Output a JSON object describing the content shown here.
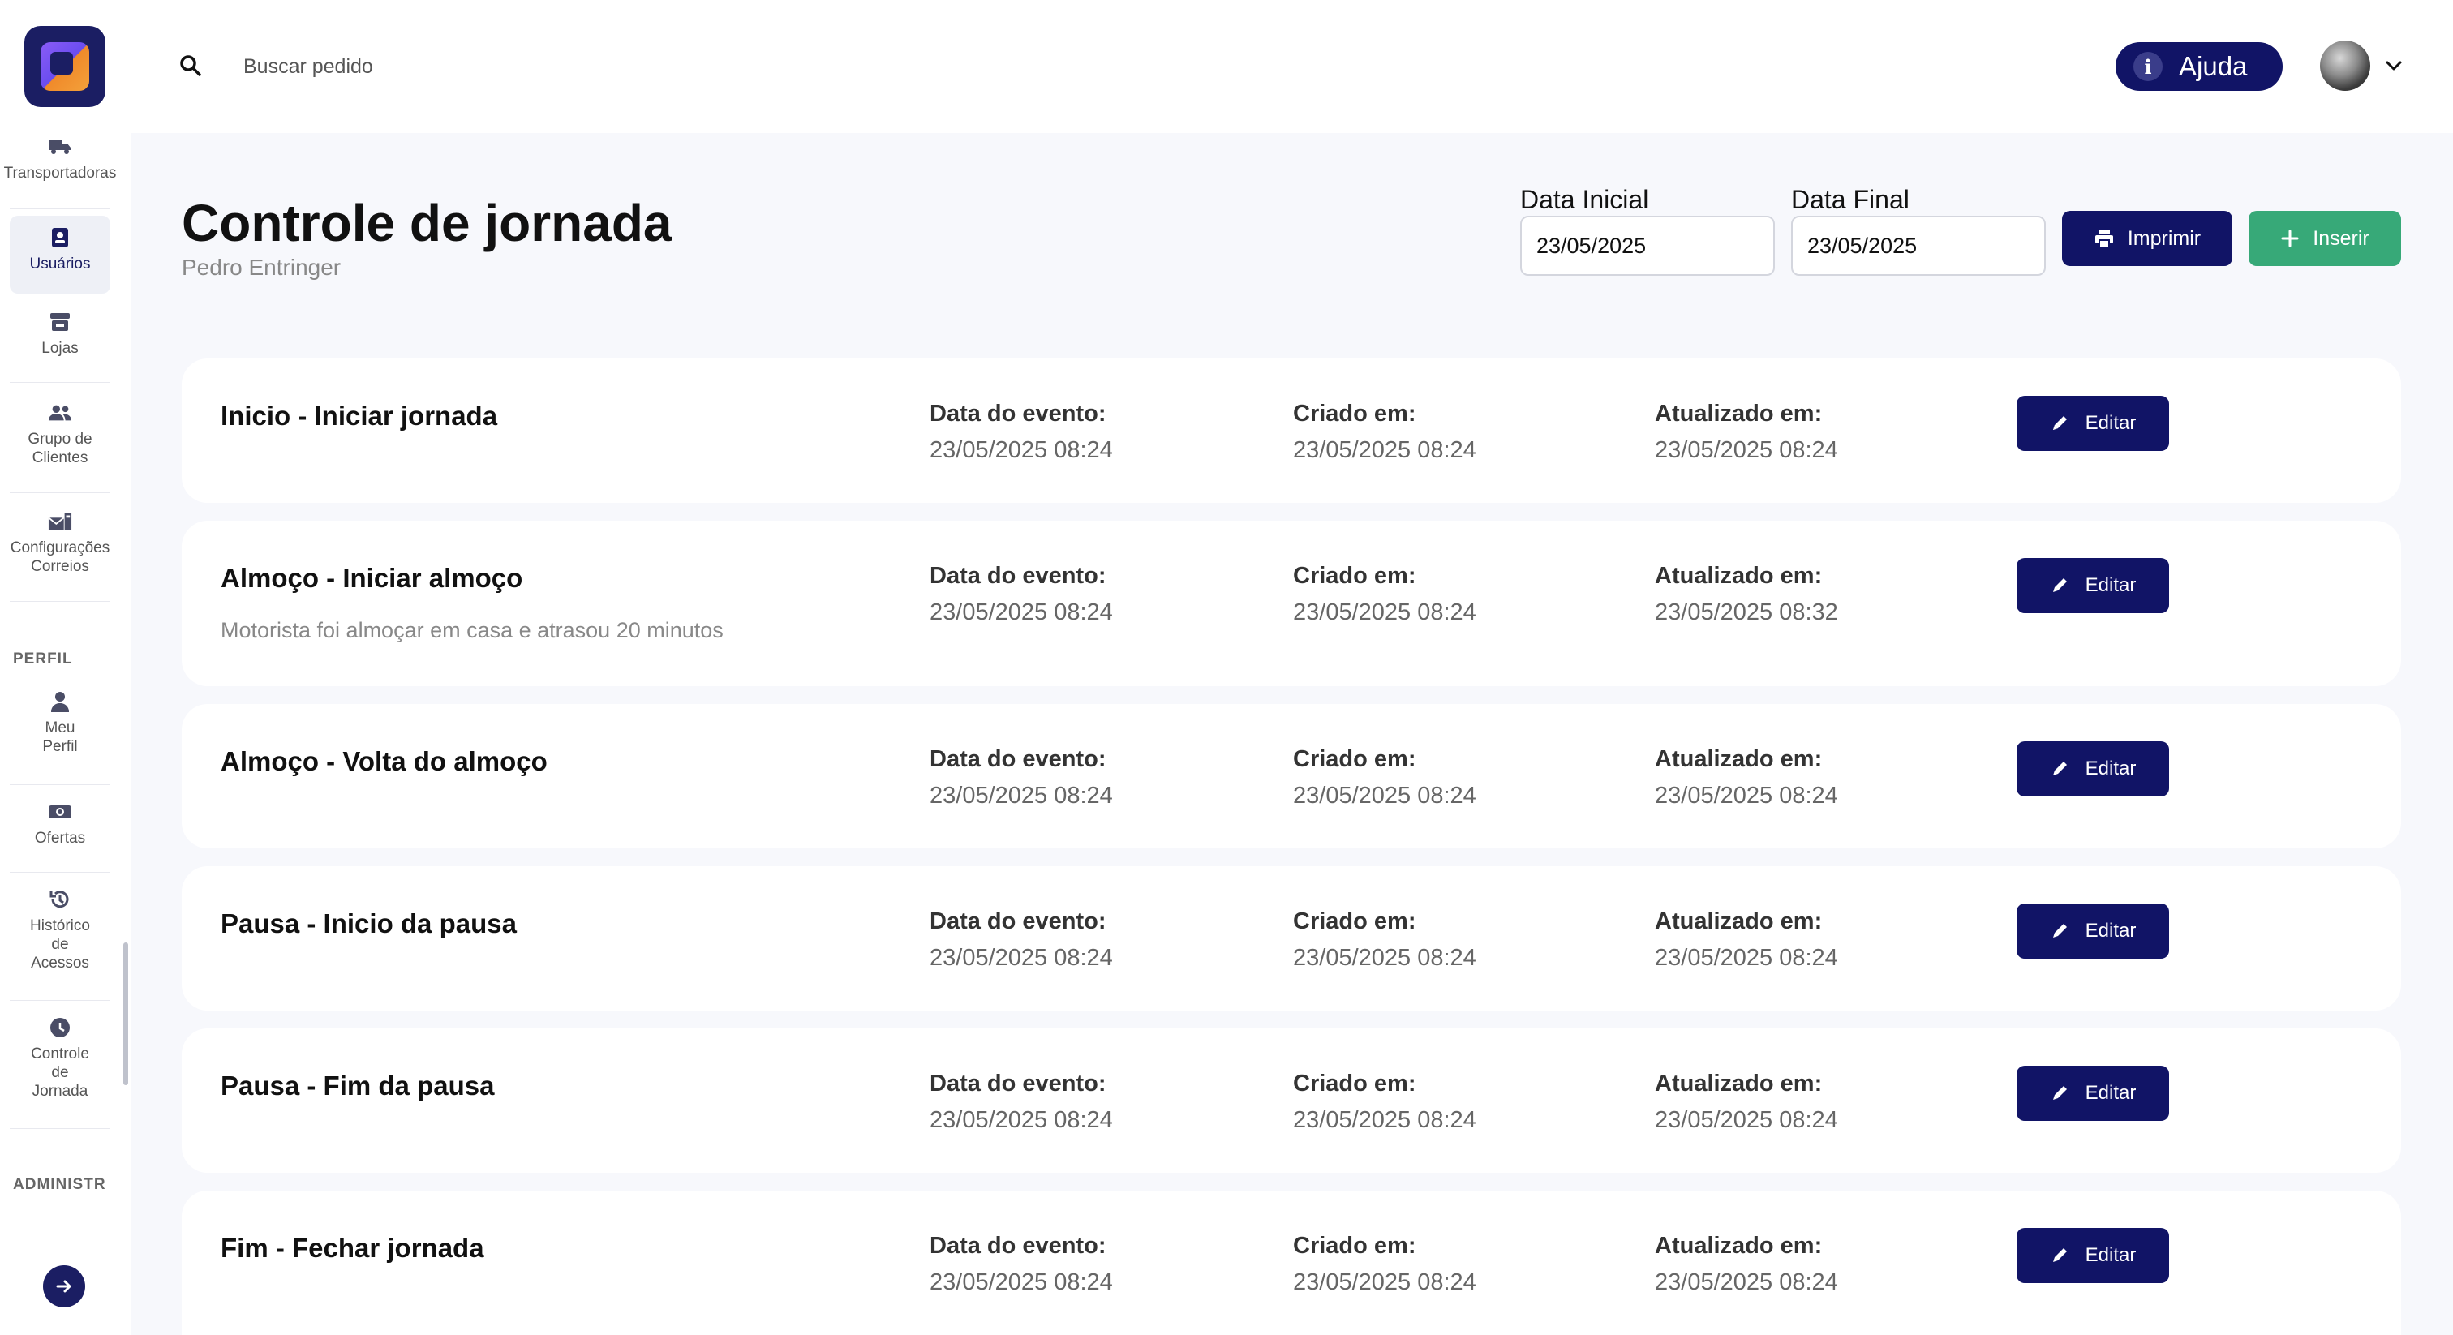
{
  "sidebar": {
    "items": [
      {
        "label": "Transportadoras",
        "icon": "truck-icon"
      },
      {
        "label": "Usuários",
        "icon": "user-badge-icon",
        "active": true
      },
      {
        "label": "Lojas",
        "icon": "store-icon"
      },
      {
        "label": "Grupo de Clientes",
        "icon": "group-icon"
      },
      {
        "label": "Configurações Correios",
        "icon": "mail-config-icon"
      },
      {
        "label": "Meu Perfil",
        "icon": "person-icon"
      },
      {
        "label": "Ofertas",
        "icon": "money-icon"
      },
      {
        "label": "Histórico de Acessos",
        "icon": "history-icon"
      },
      {
        "label": "Controle de Jornada",
        "icon": "clock-icon"
      }
    ],
    "sections": {
      "perfil": "PERFIL",
      "admin": "ADMINISTR"
    }
  },
  "topbar": {
    "search_placeholder": "Buscar pedido",
    "help_label": "Ajuda"
  },
  "header": {
    "title": "Controle de jornada",
    "subtitle": "Pedro Entringer",
    "start_label": "Data Inicial",
    "start_value": "23/05/2025",
    "end_label": "Data Final",
    "end_value": "23/05/2025",
    "print_label": "Imprimir",
    "insert_label": "Inserir"
  },
  "column_labels": {
    "event": "Data do evento:",
    "created": "Criado em:",
    "updated": "Atualizado em:",
    "edit": "Editar"
  },
  "events": [
    {
      "title": "Inicio - Iniciar jornada",
      "note": "",
      "event_date": "23/05/2025 08:24",
      "created": "23/05/2025 08:24",
      "updated": "23/05/2025 08:24"
    },
    {
      "title": "Almoço - Iniciar almoço",
      "note": "Motorista foi almoçar em casa e atrasou 20 minutos",
      "event_date": "23/05/2025 08:24",
      "created": "23/05/2025 08:24",
      "updated": "23/05/2025 08:32"
    },
    {
      "title": "Almoço - Volta do almoço",
      "note": "",
      "event_date": "23/05/2025 08:24",
      "created": "23/05/2025 08:24",
      "updated": "23/05/2025 08:24"
    },
    {
      "title": "Pausa - Inicio da pausa",
      "note": "",
      "event_date": "23/05/2025 08:24",
      "created": "23/05/2025 08:24",
      "updated": "23/05/2025 08:24"
    },
    {
      "title": "Pausa - Fim da pausa",
      "note": "",
      "event_date": "23/05/2025 08:24",
      "created": "23/05/2025 08:24",
      "updated": "23/05/2025 08:24"
    },
    {
      "title": "Fim - Fechar jornada",
      "note": "",
      "event_date": "23/05/2025 08:24",
      "created": "23/05/2025 08:24",
      "updated": "23/05/2025 08:24"
    }
  ],
  "colors": {
    "navy": "#111466",
    "green": "#37a978",
    "background": "#f7f8fc"
  }
}
